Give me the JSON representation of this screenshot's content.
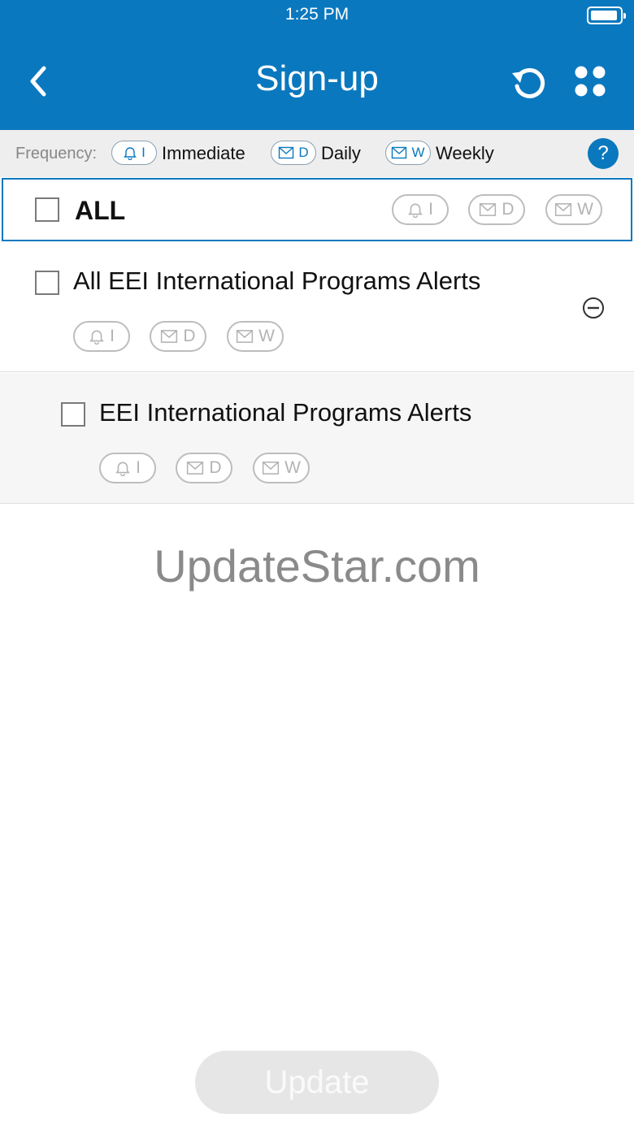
{
  "status_bar": {
    "time": "1:25 PM"
  },
  "header": {
    "title": "Sign-up"
  },
  "frequency_bar": {
    "label": "Frequency:",
    "items": [
      {
        "code": "I",
        "text": "Immediate",
        "icon": "bell-icon"
      },
      {
        "code": "D",
        "text": "Daily",
        "icon": "mail-icon"
      },
      {
        "code": "W",
        "text": "Weekly",
        "icon": "mail-icon"
      }
    ],
    "help": "?"
  },
  "rows": {
    "all": {
      "label": "ALL",
      "pills": [
        "I",
        "D",
        "W"
      ]
    },
    "group": {
      "label": "All EEI International Programs Alerts",
      "pills": [
        "I",
        "D",
        "W"
      ]
    },
    "child": {
      "label": "EEI International Programs Alerts",
      "pills": [
        "I",
        "D",
        "W"
      ]
    }
  },
  "watermark": "UpdateStar.com",
  "update_button": "Update",
  "colors": {
    "accent": "#0a78be",
    "pill_border": "#bdbdbd",
    "muted": "#888888"
  }
}
